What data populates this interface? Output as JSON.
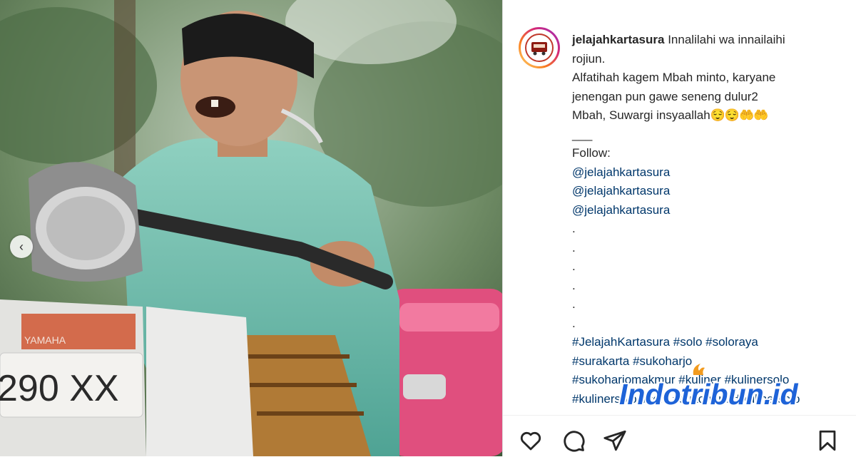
{
  "post": {
    "username": "jelajahkartasura",
    "caption_lines": [
      "Innalilahi wa innailaihi",
      "rojiun.",
      "Alfatihah kagem Mbah minto, karyane",
      "jenengan pun gawe seneng dulur2",
      "Mbah, Suwargi insyaallah",
      "___",
      "Follow:"
    ],
    "emojis": "😌😌🤲🤲",
    "mentions": [
      "@jelajahkartasura",
      "@jelajahkartasura",
      "@jelajahkartasura"
    ],
    "dots": [
      ".",
      ".",
      ".",
      ".",
      ".",
      "."
    ],
    "hashtag_lines": [
      [
        "#JelajahKartasura",
        "#solo",
        "#soloraya"
      ],
      [
        "#surakarta",
        "#sukoharjo"
      ],
      [
        "#sukoharjomakmur",
        "#kuliner",
        "#kulinersolo"
      ],
      [
        "#kulinersolo",
        "#solo",
        "#sukoharjo",
        "#kulinersolo"
      ]
    ]
  },
  "photo": {
    "plate_text": "290 XX",
    "brand_text": "YAMAHA"
  },
  "watermark": {
    "text": "Indotribun.id"
  },
  "icons": {
    "prev": "chevron-left-icon",
    "like": "heart-icon",
    "comment": "comment-icon",
    "share": "paper-plane-icon",
    "save": "bookmark-icon"
  },
  "colors": {
    "link": "#00376b",
    "text": "#262626",
    "watermark": "#1e63d8"
  }
}
